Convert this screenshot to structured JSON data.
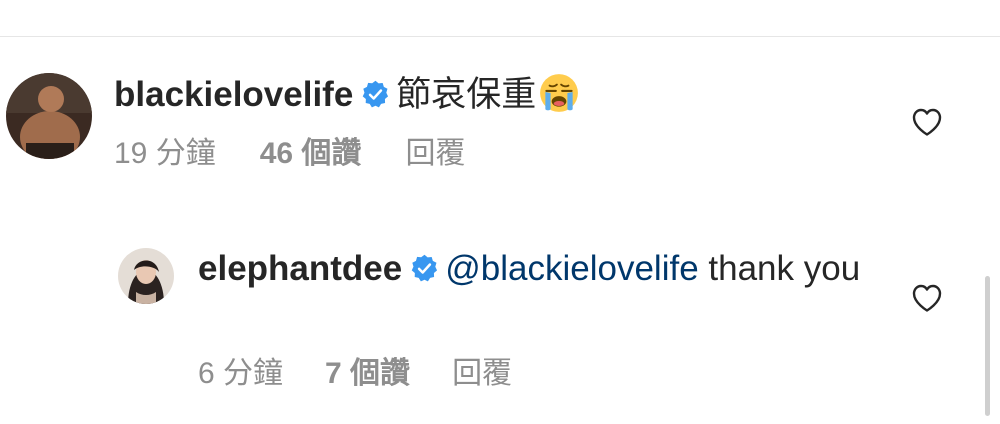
{
  "comments": [
    {
      "username": "blackielovelife",
      "text": "節哀保重",
      "emoji": "loudly-crying-face-emoji",
      "time": "19 分鐘",
      "likes": "46 個讚",
      "reply": "回覆"
    }
  ],
  "replies": [
    {
      "username": "elephantdee",
      "mention": "@blackielovelife",
      "text": "thank you",
      "time": "6 分鐘",
      "likes": "7 個讚",
      "reply": "回覆"
    }
  ],
  "icons": {
    "verified": "verified-badge-icon",
    "like": "heart-outline-icon"
  },
  "colors": {
    "text": "#262626",
    "secondary": "#8e8e8e",
    "mention": "#00376b",
    "verified": "#3897f0"
  }
}
